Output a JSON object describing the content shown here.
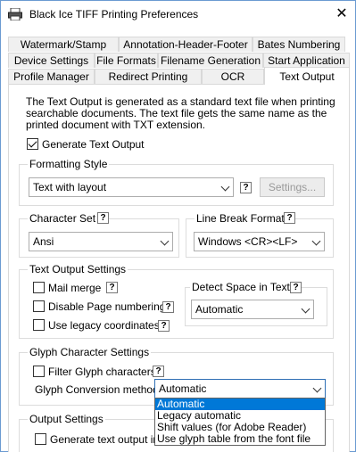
{
  "window": {
    "title": "Black Ice TIFF Printing Preferences",
    "close": "✕"
  },
  "tabs": {
    "row1": [
      "Watermark/Stamp",
      "Annotation-Header-Footer",
      "Bates Numbering"
    ],
    "row2": [
      "Device Settings",
      "File Formats",
      "Filename Generation",
      "Start Application"
    ],
    "row3": [
      "Profile Manager",
      "Redirect Printing",
      "OCR",
      "Text Output"
    ]
  },
  "description": "The Text Output is generated as a standard text file when printing searchable documents. The text file gets the same name as the printed document with TXT extension.",
  "generate_text_output": {
    "label": "Generate Text Output",
    "checked": true
  },
  "formatting": {
    "title": "Formatting Style",
    "value": "Text with layout",
    "help": "?",
    "settings_button": "Settings..."
  },
  "charset": {
    "title": "Character Set",
    "help": "?",
    "value": "Ansi"
  },
  "linebreak": {
    "title": "Line Break Format",
    "help": "?",
    "value": "Windows <CR><LF>"
  },
  "text_output_settings": {
    "title": "Text Output Settings",
    "mail_merge": "Mail merge",
    "disable_page_numbering": "Disable Page numbering",
    "use_legacy_coordinates": "Use legacy coordinates",
    "help": "?",
    "detect_space": {
      "title": "Detect Space in Text",
      "help": "?",
      "value": "Automatic"
    }
  },
  "glyph": {
    "title": "Glyph Character Settings",
    "filter_label": "Filter Glyph characters",
    "help": "?",
    "conversion_label": "Glyph Conversion method:",
    "conversion_value": "Automatic",
    "options": [
      "Automatic",
      "Legacy automatic",
      "Shift values (for Adobe Reader)",
      "Use glyph table from the font file"
    ]
  },
  "output_settings": {
    "title": "Output Settings",
    "multi_label": "Generate text output in m"
  },
  "colors": {
    "selection": "#0078d7",
    "focus": "#2f6fb5"
  }
}
